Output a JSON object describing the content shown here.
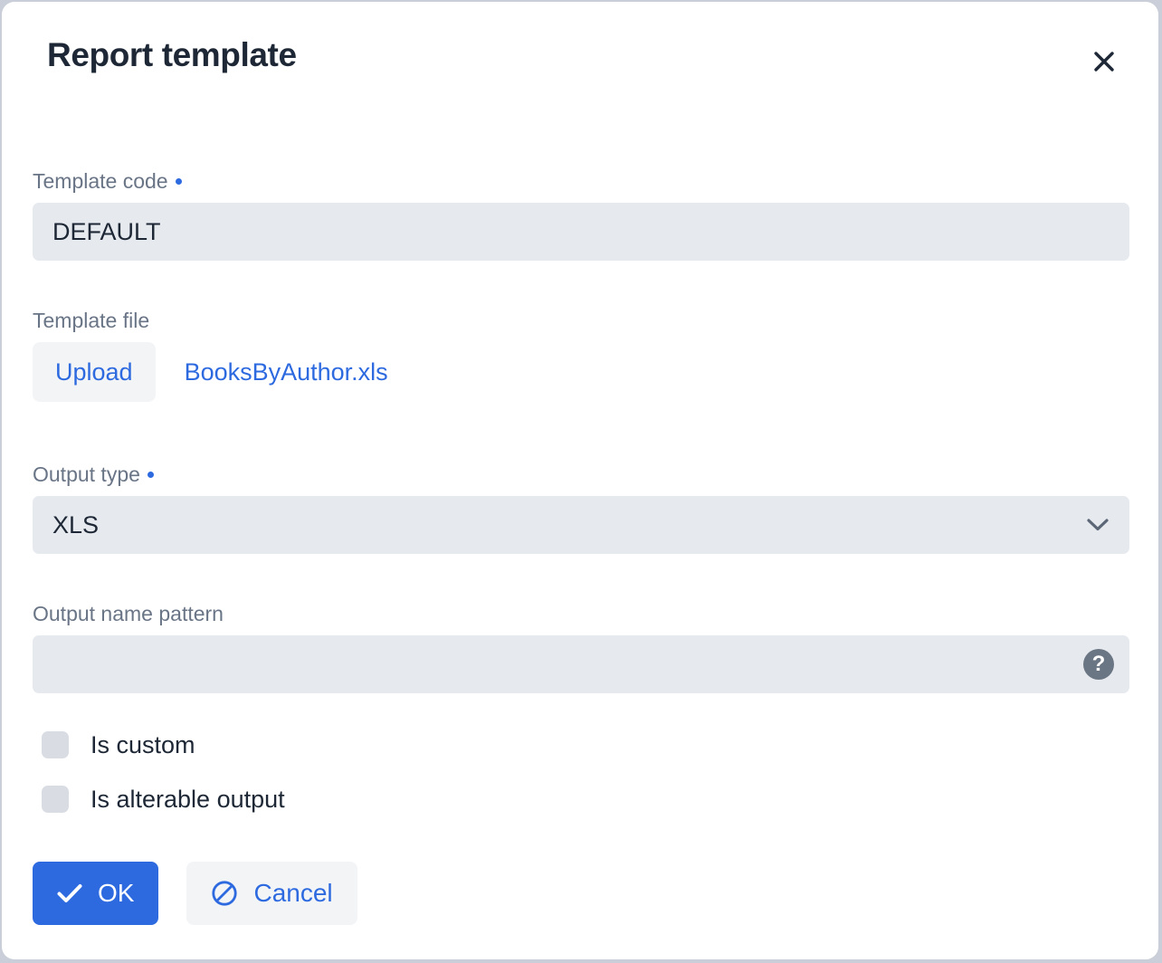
{
  "dialog": {
    "title": "Report template",
    "close_label": "×",
    "close_icon": "close-icon"
  },
  "fields": {
    "template_code": {
      "label": "Template code",
      "required": true,
      "value": "DEFAULT",
      "placeholder": ""
    },
    "template_file": {
      "label": "Template file",
      "required": false,
      "upload_label": "Upload",
      "file_name": "BooksByAuthor.xls"
    },
    "output_type": {
      "label": "Output type",
      "required": true,
      "value": "XLS",
      "caret_icon": "chevron-down-icon",
      "options": [
        "XLS"
      ]
    },
    "output_name_pattern": {
      "label": "Output name pattern",
      "required": false,
      "value": "",
      "placeholder": "",
      "help_icon": "help-circle-icon",
      "help_glyph": "?"
    }
  },
  "checkboxes": [
    {
      "label": "Is custom",
      "checked": false
    },
    {
      "label": "Is alterable output",
      "checked": false
    }
  ],
  "footer": {
    "ok_label": "OK",
    "ok_icon": "check-icon",
    "cancel_label": "Cancel",
    "cancel_icon": "ban-icon"
  },
  "colors": {
    "accent": "#2d6ae0",
    "input_bg": "#e6e9ed",
    "subtle_bg": "#f3f4f6",
    "label": "#697586",
    "text": "#1d2735",
    "checkbox": "#d9dde3",
    "help_bg": "#6b7685",
    "backdrop": "#c9ced8"
  }
}
